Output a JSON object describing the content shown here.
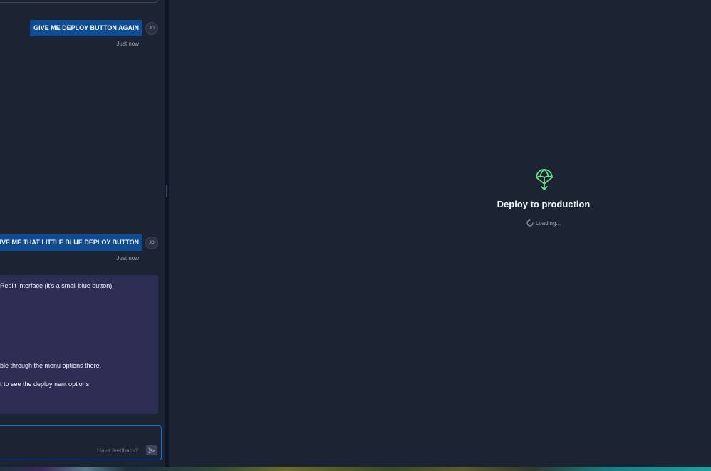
{
  "chat": {
    "messages": [
      {
        "role": "user",
        "text": "GIVE ME DEPLOY BUTTON AGAIN",
        "avatar": "JO",
        "time": "Just now"
      },
      {
        "role": "user",
        "text": "GIVE ME THAT LITTLE BLUE DEPLOY BUTTON",
        "avatar": "JO",
        "time": "Just now"
      }
    ],
    "ai_lines": [
      "Replit interface (it's a small blue button).",
      "ble through the menu options there.",
      "t to see the deployment options."
    ],
    "input": {
      "feedback_label": "Have feedback?",
      "send_icon": "send-icon"
    }
  },
  "deploy": {
    "title": "Deploy to production",
    "loading_text": "Loading...",
    "icon": "parachute-icon",
    "accent_color": "#73e08f"
  },
  "colors": {
    "user_bubble": "#0f4c92",
    "ai_card": "#2e2e54",
    "input_border": "#0079f2",
    "panel_bg": "#1c2333"
  }
}
